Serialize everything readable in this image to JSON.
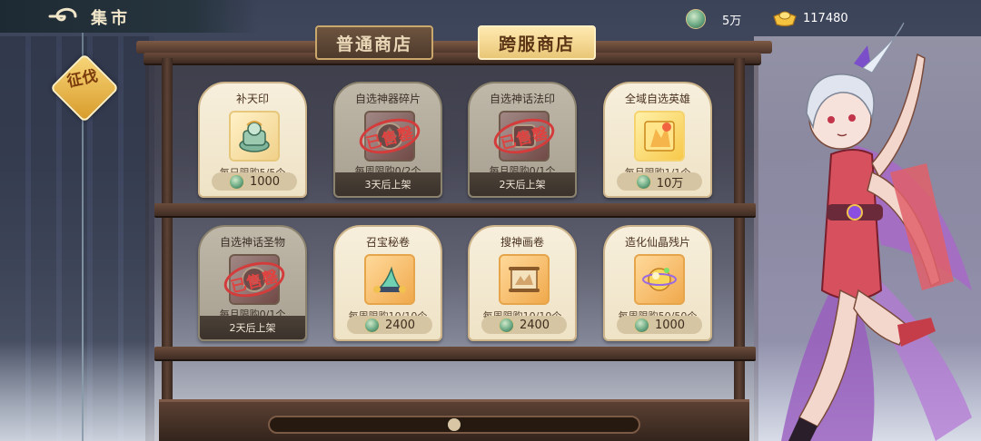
{
  "header": {
    "title": "集市",
    "back_icon": "back-swirl-icon"
  },
  "side_badge": {
    "label": "征伐"
  },
  "currencies": [
    {
      "name": "jade-coin",
      "value": "5万",
      "icon": "jade-coin-icon"
    },
    {
      "name": "gold-ingot",
      "value": "117480",
      "icon": "gold-ingot-icon"
    }
  ],
  "tabs": [
    {
      "label": "普通商店",
      "active": false
    },
    {
      "label": "跨服商店",
      "active": true
    }
  ],
  "shop": {
    "items": [
      {
        "name": "补天印",
        "limit": "每日限购5/5个",
        "price": "1000",
        "sold_out": false,
        "icon": "jade-seal-icon"
      },
      {
        "name": "自选神器碎片",
        "limit": "每周限购0/2个",
        "restock": "3天后上架",
        "sold_out": true,
        "stamp": "已售罄",
        "icon": "artifact-fragment-icon"
      },
      {
        "name": "自选神话法印",
        "limit": "每月限购0/1个",
        "restock": "2天后上架",
        "sold_out": true,
        "stamp": "已售罄",
        "icon": "myth-seal-icon"
      },
      {
        "name": "全域自选英雄",
        "limit": "每月限购1/1个",
        "price": "10万",
        "sold_out": false,
        "icon": "hero-selector-icon"
      },
      {
        "name": "自选神话圣物",
        "limit": "每月限购0/1个",
        "restock": "2天后上架",
        "sold_out": true,
        "stamp": "已售罄",
        "icon": "myth-relic-icon"
      },
      {
        "name": "召宝秘卷",
        "limit": "每周限购10/10个",
        "price": "2400",
        "sold_out": false,
        "icon": "treasure-scroll-icon"
      },
      {
        "name": "搜神画卷",
        "limit": "每周限购10/10个",
        "price": "2400",
        "sold_out": false,
        "icon": "painting-scroll-icon"
      },
      {
        "name": "造化仙晶残片",
        "limit": "每周限购50/50个",
        "price": "1000",
        "sold_out": false,
        "icon": "crystal-shard-icon"
      }
    ]
  },
  "colors": {
    "tab_active": "#e9c777",
    "tab_inactive": "#4e3a2b",
    "stamp_red": "#e0423f",
    "card_bg": "#f7efdc"
  }
}
